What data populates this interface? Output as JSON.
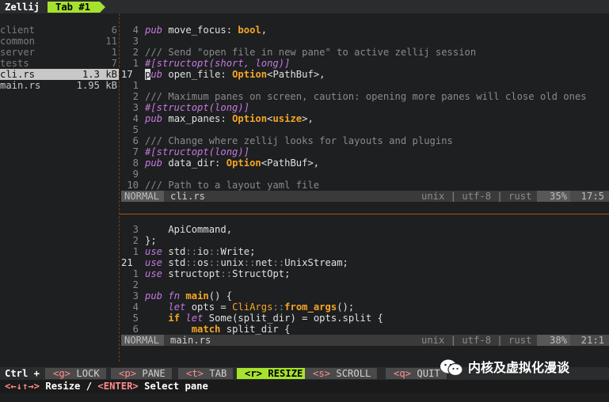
{
  "app": {
    "name": "Zellij",
    "active_tab": "Tab #1"
  },
  "file_tree": [
    {
      "name": "client",
      "size": "6",
      "kind": "dir"
    },
    {
      "name": "common",
      "size": "11",
      "kind": "dir"
    },
    {
      "name": "server",
      "size": "1",
      "kind": "dir"
    },
    {
      "name": "tests",
      "size": "7",
      "kind": "dir"
    },
    {
      "name": "cli.rs",
      "size": "1.3 kB",
      "kind": "file",
      "selected": true
    },
    {
      "name": "main.rs",
      "size": "1.95 kB",
      "kind": "file"
    }
  ],
  "top_pane": {
    "lines": [
      {
        "ln": "4",
        "tokens": [
          [
            "kw",
            "pub"
          ],
          [
            "id",
            " move_focus: "
          ],
          [
            "bool",
            "bool"
          ],
          [
            "id",
            ","
          ]
        ]
      },
      {
        "ln": "3",
        "tokens": []
      },
      {
        "ln": "2",
        "tokens": [
          [
            "cm",
            "/// Send \"open file in new pane\" to active zellij session"
          ]
        ]
      },
      {
        "ln": "1",
        "tokens": [
          [
            "at",
            "#[structopt(short, long)]"
          ]
        ]
      },
      {
        "ln": "17",
        "current": true,
        "tokens": [
          [
            "cursor",
            "p"
          ],
          [
            "kw",
            "ub"
          ],
          [
            "id",
            " open_file: "
          ],
          [
            "ty",
            "Option"
          ],
          [
            "id",
            "<PathBuf>,"
          ]
        ]
      },
      {
        "ln": "1",
        "tokens": []
      },
      {
        "ln": "2",
        "tokens": [
          [
            "cm",
            "/// Maximum panes on screen, caution: opening more panes will close old ones"
          ]
        ]
      },
      {
        "ln": "3",
        "tokens": [
          [
            "at",
            "#[structopt(long)]"
          ]
        ]
      },
      {
        "ln": "4",
        "tokens": [
          [
            "kw",
            "pub"
          ],
          [
            "id",
            " max_panes: "
          ],
          [
            "ty",
            "Option"
          ],
          [
            "id",
            "<"
          ],
          [
            "ty",
            "usize"
          ],
          [
            "id",
            ">,"
          ]
        ]
      },
      {
        "ln": "5",
        "tokens": []
      },
      {
        "ln": "6",
        "tokens": [
          [
            "cm",
            "/// Change where zellij looks for layouts and plugins"
          ]
        ]
      },
      {
        "ln": "7",
        "tokens": [
          [
            "at",
            "#[structopt(long)]"
          ]
        ]
      },
      {
        "ln": "8",
        "tokens": [
          [
            "kw",
            "pub"
          ],
          [
            "id",
            " data_dir: "
          ],
          [
            "ty",
            "Option"
          ],
          [
            "id",
            "<PathBuf>,"
          ]
        ]
      },
      {
        "ln": "9",
        "tokens": []
      },
      {
        "ln": "10",
        "tokens": [
          [
            "cm",
            "/// Path to a layout yaml file"
          ]
        ]
      }
    ],
    "status": {
      "mode": "NORMAL",
      "file": "cli.rs",
      "info": "unix | utf-8 | rust",
      "percent": "35%",
      "position": "17:5"
    }
  },
  "bottom_pane": {
    "lines": [
      {
        "ln": "3",
        "tokens": [
          [
            "id",
            "    ApiCommand,"
          ]
        ]
      },
      {
        "ln": "2",
        "tokens": [
          [
            "id",
            "};"
          ]
        ]
      },
      {
        "ln": "1",
        "tokens": [
          [
            "kw",
            "use"
          ],
          [
            "id",
            " std"
          ],
          [
            "cm",
            "::"
          ],
          [
            "id",
            "io"
          ],
          [
            "cm",
            "::"
          ],
          [
            "id",
            "Write;"
          ]
        ]
      },
      {
        "ln": "21",
        "current": true,
        "tokens": [
          [
            "kw",
            "use"
          ],
          [
            "id",
            " std"
          ],
          [
            "cm",
            "::"
          ],
          [
            "id",
            "os"
          ],
          [
            "cm",
            "::"
          ],
          [
            "id",
            "unix"
          ],
          [
            "cm",
            "::"
          ],
          [
            "id",
            "net"
          ],
          [
            "cm",
            "::"
          ],
          [
            "id",
            "UnixStream;"
          ]
        ]
      },
      {
        "ln": "1",
        "tokens": [
          [
            "kw",
            "use"
          ],
          [
            "id",
            " structopt"
          ],
          [
            "cm",
            "::"
          ],
          [
            "id",
            "StructOpt;"
          ]
        ]
      },
      {
        "ln": "2",
        "tokens": []
      },
      {
        "ln": "3",
        "tokens": [
          [
            "kw",
            "pub"
          ],
          [
            "id",
            " "
          ],
          [
            "kw",
            "fn"
          ],
          [
            "id",
            " "
          ],
          [
            "ty",
            "main"
          ],
          [
            "id",
            "() {"
          ]
        ]
      },
      {
        "ln": "4",
        "tokens": [
          [
            "id",
            "    "
          ],
          [
            "kw",
            "let"
          ],
          [
            "id",
            " opts = "
          ],
          [
            "fn",
            "CliArgs"
          ],
          [
            "cm",
            "::"
          ],
          [
            "ty",
            "from_args"
          ],
          [
            "id",
            "();"
          ]
        ]
      },
      {
        "ln": "5",
        "tokens": [
          [
            "id",
            "    "
          ],
          [
            "ty",
            "if"
          ],
          [
            "id",
            " "
          ],
          [
            "kw",
            "let"
          ],
          [
            "id",
            " Some(split_dir) = opts.split {"
          ]
        ]
      },
      {
        "ln": "6",
        "tokens": [
          [
            "id",
            "        "
          ],
          [
            "ty",
            "match"
          ],
          [
            "id",
            " split_dir {"
          ]
        ]
      }
    ],
    "status": {
      "mode": "NORMAL",
      "file": "main.rs",
      "info": "unix | utf-8 | rust",
      "percent": "38%",
      "position": "21:1"
    }
  },
  "keybar": {
    "ctrl_label": "Ctrl +",
    "keys": [
      {
        "key": "<g>",
        "label": "LOCK",
        "active": false
      },
      {
        "key": "<p>",
        "label": "PANE",
        "active": false
      },
      {
        "key": "<t>",
        "label": "TAB",
        "active": false
      },
      {
        "key": "<r>",
        "label": "RESIZE",
        "active": true
      },
      {
        "key": "<s>",
        "label": "SCROLL",
        "active": false
      },
      {
        "key": "<q>",
        "label": "QUIT",
        "active": false
      }
    ]
  },
  "hint": {
    "arrows": "<←↓↑→>",
    "resize_label": " Resize / ",
    "enter_key": "<ENTER>",
    "enter_label": " Select pane"
  },
  "watermark": {
    "text": "内核及虚拟化漫谈",
    "icon": "wechat-icon"
  },
  "colors": {
    "accent": "#a6e22e",
    "divider": "#a9520f",
    "keyword": "#c678dd",
    "type": "#f5a623"
  }
}
